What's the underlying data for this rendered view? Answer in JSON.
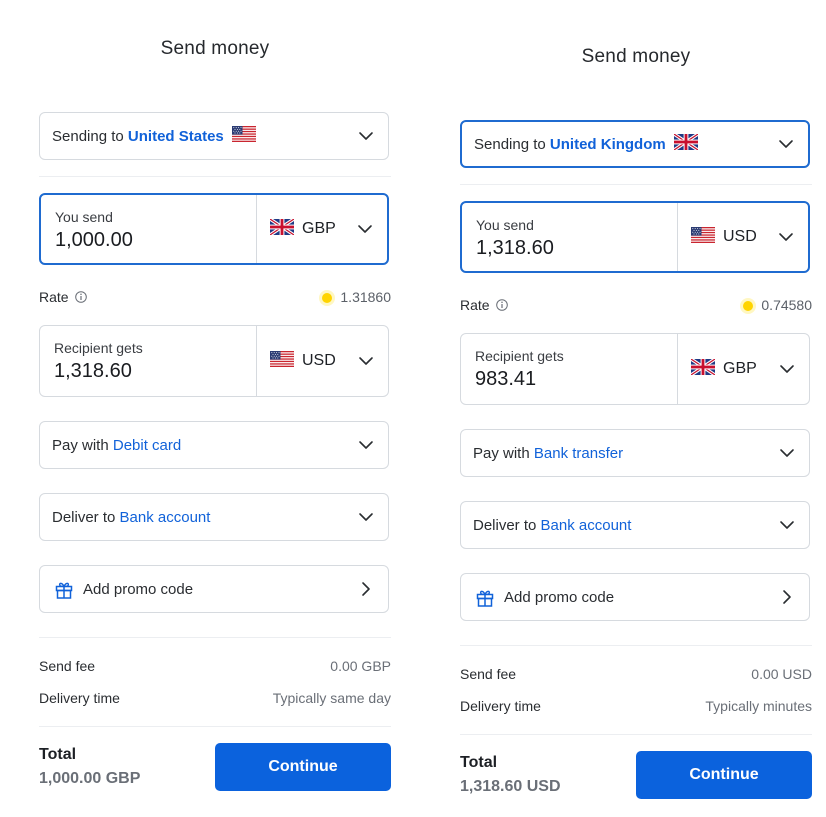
{
  "colors": {
    "accent": "#0b62dd",
    "link": "#1162d9",
    "rate_dot": "#ffd400",
    "border": "#d6dadf"
  },
  "panels": [
    {
      "title": "Send money",
      "sending_to": {
        "prefix": "Sending to",
        "country": "United States",
        "flag": "us-flag-icon"
      },
      "you_send": {
        "label": "You send",
        "amount": "1,000.00",
        "currency": "GBP",
        "flag": "uk-flag-icon"
      },
      "rate": {
        "label": "Rate",
        "value": "1.31860"
      },
      "recipient_gets": {
        "label": "Recipient gets",
        "amount": "1,318.60",
        "currency": "USD",
        "flag": "us-flag-icon"
      },
      "pay_with": {
        "prefix": "Pay with",
        "method": "Debit card"
      },
      "deliver_to": {
        "prefix": "Deliver to",
        "method": "Bank account"
      },
      "promo": {
        "label": "Add promo code"
      },
      "send_fee": {
        "label": "Send fee",
        "value": "0.00 GBP"
      },
      "delivery_time": {
        "label": "Delivery time",
        "value": "Typically same day"
      },
      "total": {
        "label": "Total",
        "value": "1,000.00 GBP"
      },
      "continue_label": "Continue"
    },
    {
      "title": "Send money",
      "sending_to": {
        "prefix": "Sending to",
        "country": "United Kingdom",
        "flag": "uk-flag-icon"
      },
      "you_send": {
        "label": "You send",
        "amount": "1,318.60",
        "currency": "USD",
        "flag": "us-flag-icon"
      },
      "rate": {
        "label": "Rate",
        "value": "0.74580"
      },
      "recipient_gets": {
        "label": "Recipient gets",
        "amount": "983.41",
        "currency": "GBP",
        "flag": "uk-flag-icon"
      },
      "pay_with": {
        "prefix": "Pay with",
        "method": "Bank transfer"
      },
      "deliver_to": {
        "prefix": "Deliver to",
        "method": "Bank account"
      },
      "promo": {
        "label": "Add promo code"
      },
      "send_fee": {
        "label": "Send fee",
        "value": "0.00 USD"
      },
      "delivery_time": {
        "label": "Delivery time",
        "value": "Typically minutes"
      },
      "total": {
        "label": "Total",
        "value": "1,318.60 USD"
      },
      "continue_label": "Continue"
    }
  ]
}
